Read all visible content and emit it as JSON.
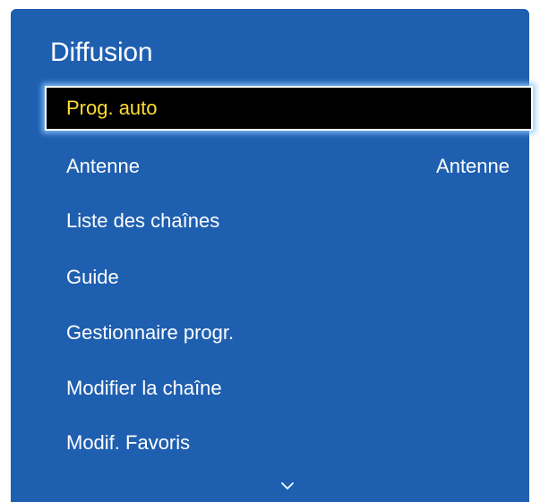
{
  "panel": {
    "title": "Diffusion"
  },
  "menu": {
    "items": [
      {
        "label": "Prog. auto",
        "value": "",
        "selected": true
      },
      {
        "label": "Antenne",
        "value": "Antenne",
        "selected": false
      },
      {
        "label": "Liste des chaînes",
        "value": "",
        "selected": false
      },
      {
        "label": "Guide",
        "value": "",
        "selected": false
      },
      {
        "label": "Gestionnaire progr.",
        "value": "",
        "selected": false
      },
      {
        "label": "Modifier la chaîne",
        "value": "",
        "selected": false
      },
      {
        "label": "Modif. Favoris",
        "value": "",
        "selected": false
      }
    ],
    "more_icon": "chevron-down-icon"
  },
  "colors": {
    "panel_background": "#1f5fb0",
    "selected_background": "#000000",
    "selected_text": "#ffdd33",
    "text": "#ffffff"
  }
}
